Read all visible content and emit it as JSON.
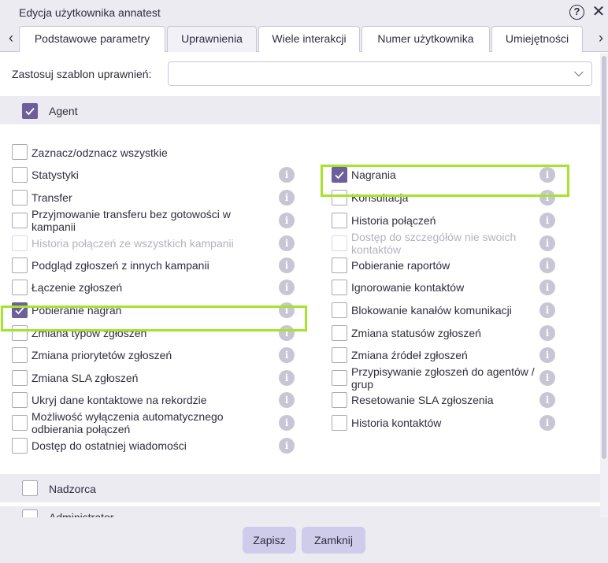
{
  "window": {
    "title": "Edycja użytkownika annatest"
  },
  "tabs": [
    "Podstawowe parametry",
    "Uprawnienia",
    "Wiele interakcji",
    "Numer użytkownika",
    "Umiejętności"
  ],
  "template": {
    "label": "Zastosuj szablon uprawnień:",
    "value": ""
  },
  "sections": {
    "agent": "Agent",
    "supervisor": "Nadzorca",
    "administrator": "Administrator"
  },
  "select_all": "Zaznacz/odznacz wszystkie",
  "left_permissions": [
    {
      "label": "Statystyki",
      "checked": false,
      "disabled": false
    },
    {
      "label": "Transfer",
      "checked": false,
      "disabled": false
    },
    {
      "label": "Przyjmowanie transferu bez gotowości w kampanii",
      "checked": false,
      "disabled": false
    },
    {
      "label": "Historia połączeń ze wszystkich kampanii",
      "checked": false,
      "disabled": true
    },
    {
      "label": "Podgląd zgłoszeń z innych kampanii",
      "checked": false,
      "disabled": false
    },
    {
      "label": "Łączenie zgłoszeń",
      "checked": false,
      "disabled": false
    },
    {
      "label": "Pobieranie nagrań",
      "checked": true,
      "disabled": false
    },
    {
      "label": "Zmiana typów zgłoszeń",
      "checked": false,
      "disabled": false
    },
    {
      "label": "Zmiana priorytetów zgłoszeń",
      "checked": false,
      "disabled": false
    },
    {
      "label": "Zmiana SLA zgłoszeń",
      "checked": false,
      "disabled": false
    },
    {
      "label": "Ukryj dane kontaktowe na rekordzie",
      "checked": false,
      "disabled": false
    },
    {
      "label": "Możliwość wyłączenia automatycznego odbierania połączeń",
      "checked": false,
      "disabled": false
    },
    {
      "label": "Dostęp do ostatniej wiadomości",
      "checked": false,
      "disabled": false
    }
  ],
  "right_permissions": [
    {
      "label": "Nagrania",
      "checked": true,
      "disabled": false
    },
    {
      "label": "Konsultacja",
      "checked": false,
      "disabled": false
    },
    {
      "label": "Historia połączeń",
      "checked": false,
      "disabled": false
    },
    {
      "label": "Dostęp do szczegółów nie swoich kontaktów",
      "checked": false,
      "disabled": true
    },
    {
      "label": "Pobieranie raportów",
      "checked": false,
      "disabled": false
    },
    {
      "label": "Ignorowanie kontaktów",
      "checked": false,
      "disabled": false
    },
    {
      "label": "Blokowanie kanałów komunikacji",
      "checked": false,
      "disabled": false
    },
    {
      "label": "Zmiana statusów zgłoszeń",
      "checked": false,
      "disabled": false
    },
    {
      "label": "Zmiana źródeł zgłoszeń",
      "checked": false,
      "disabled": false
    },
    {
      "label": "Przypisywanie zgłoszeń do agentów / grup",
      "checked": false,
      "disabled": false
    },
    {
      "label": "Resetowanie SLA zgłoszenia",
      "checked": false,
      "disabled": false
    },
    {
      "label": "Historia kontaktów",
      "checked": false,
      "disabled": false
    }
  ],
  "info_glyph": "i",
  "icons": {
    "help": "question-circle-icon",
    "close": "close-icon",
    "checkbox_checked": "checkmark-icon",
    "info": "info-icon"
  },
  "colors": {
    "checkbox_checked": "#6d5f99",
    "highlight": "#a6e22e",
    "button": "#cfcceb"
  },
  "footer": {
    "save": "Zapisz",
    "close": "Zamknij"
  }
}
